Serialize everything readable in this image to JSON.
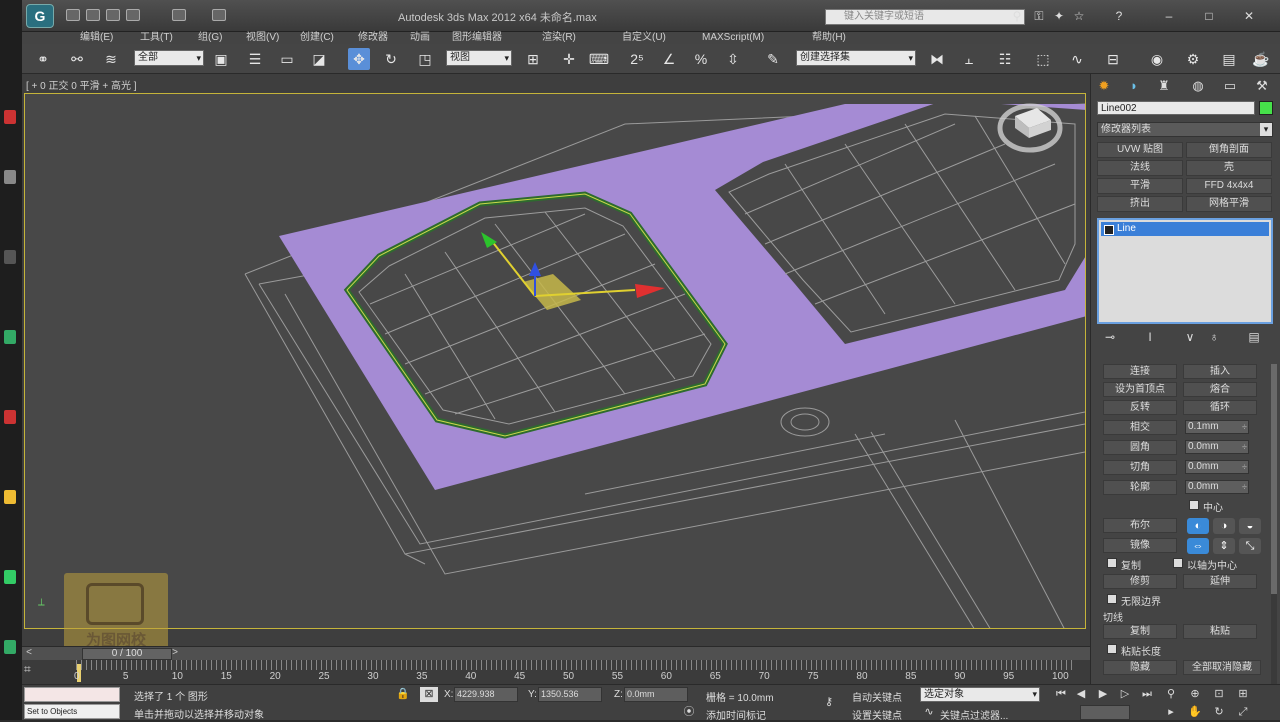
{
  "titlebar": {
    "title": "Autodesk 3ds Max  2012 x64    未命名.max",
    "search_placeholder": "键入关键字或短语"
  },
  "menu": [
    "编辑(E)",
    "工具(T)",
    "组(G)",
    "视图(V)",
    "创建(C)",
    "修改器",
    "动画",
    "图形编辑器",
    "渲染(R)",
    "自定义(U)",
    "MAXScript(M)",
    "帮助(H)"
  ],
  "toolbar": {
    "filter_select": "全部",
    "coord_select": "视图",
    "named_selection": "创建选择集"
  },
  "viewport": {
    "label": "[ + 0 正交 0 平滑 + 高光 ]"
  },
  "watermark": {
    "text": "为图网校"
  },
  "panel": {
    "object_name": "Line002",
    "object_color": "#46e04a",
    "modifier_list": "修改器列表",
    "modifier_buttons": [
      "UVW 贴图",
      "倒角剖面",
      "法线",
      "壳",
      "平滑",
      "FFD 4x4x4",
      "挤出",
      "网格平滑"
    ],
    "stack_item": "Line",
    "rollout": {
      "row1_label": "连接",
      "row1_right": "插入",
      "row2_label": "设为首顶点",
      "row2_right": "熔合",
      "row3_label": "反转",
      "row3_right": "循环",
      "crossinsert_label": "相交",
      "crossinsert_value": "0.1mm",
      "fillet_label": "圆角",
      "fillet_value": "0.0mm",
      "chamfer_label": "切角",
      "chamfer_value": "0.0mm",
      "outline_label": "轮廓",
      "outline_value": "0.0mm",
      "center_label": "中心",
      "boolean_label": "布尔",
      "mirror_label": "镜像",
      "copy_label": "复制",
      "axis_label": "以轴为中心",
      "trim_label": "修剪",
      "extend_label": "延伸",
      "infinite_label": "无限边界",
      "tangent_label": "切线",
      "tangent_copy": "复制",
      "tangent_paste": "粘贴",
      "paste_length_label": "粘贴长度",
      "hide_label": "隐藏",
      "unhide_all_label": "全部取消隐藏"
    }
  },
  "timeline": {
    "frame_counter": "0 / 100",
    "ticks": [
      "0",
      "5",
      "10",
      "15",
      "20",
      "25",
      "30",
      "35",
      "40",
      "45",
      "50",
      "55",
      "60",
      "65",
      "70",
      "75",
      "80",
      "85",
      "90",
      "95",
      "100"
    ]
  },
  "status": {
    "maxscript_line": "Set to Objects",
    "selection_text": "选择了 1 个 图形",
    "prompt_text": "单击并拖动以选择并移动对象",
    "x_value": "4229.938",
    "y_value": "1350.536",
    "z_value": "0.0mm",
    "grid_text": "栅格 = 10.0mm",
    "add_tag": "添加时间标记",
    "auto_key": "自动关键点",
    "set_key": "设置关键点",
    "selected_select": "选定对象",
    "key_filters": "关键点过滤器..."
  }
}
